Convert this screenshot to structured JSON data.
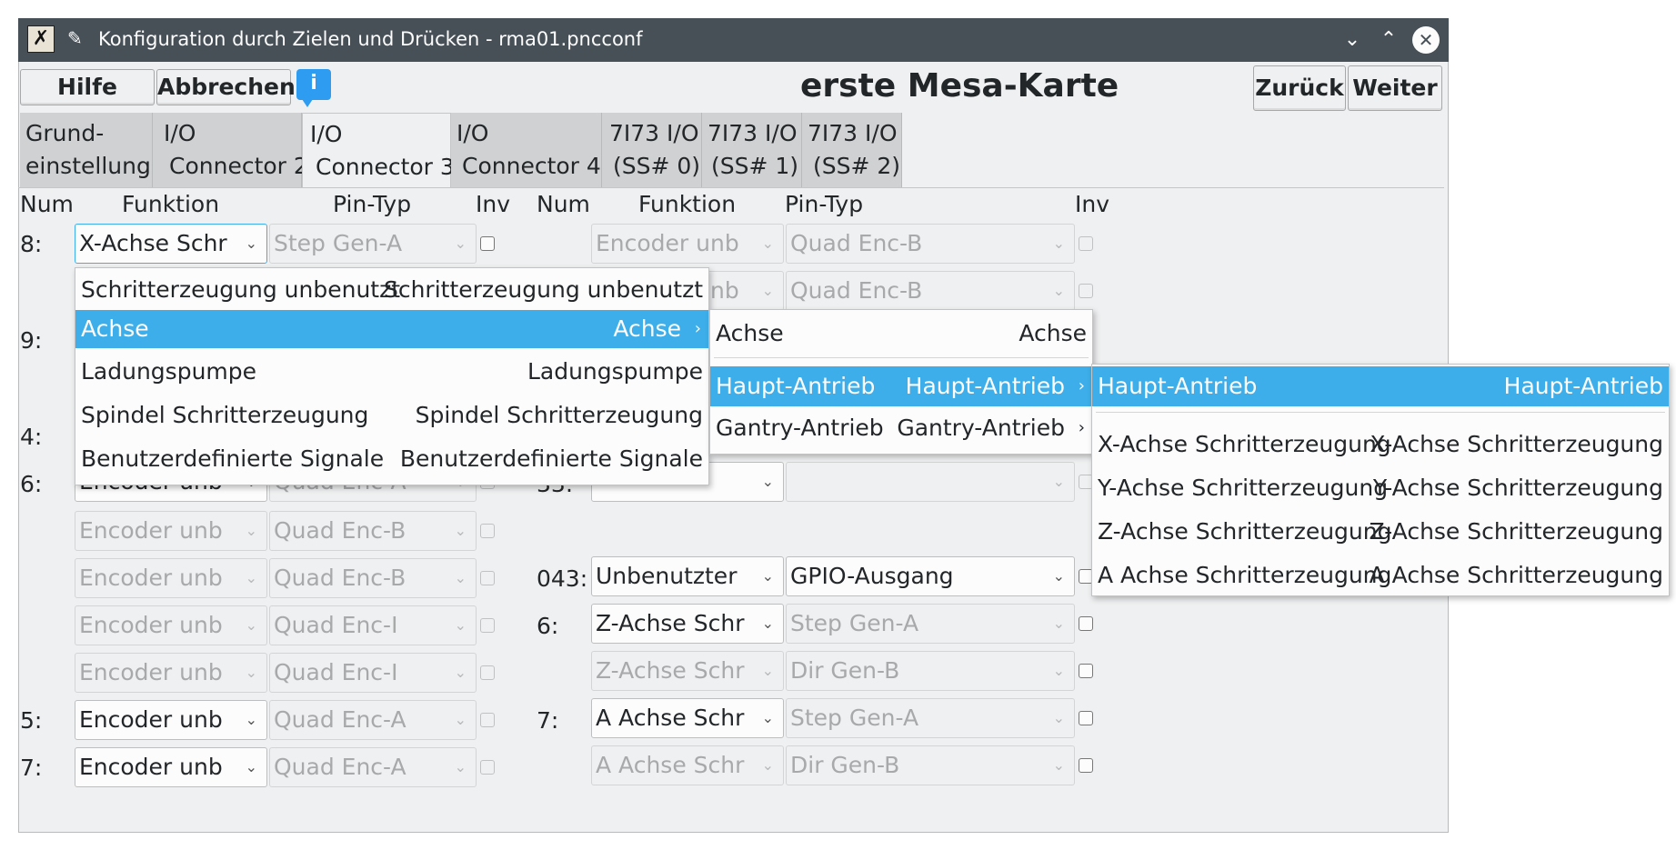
{
  "window": {
    "title": "Konfiguration durch Zielen und Drücken - rma01.pncconf"
  },
  "toolbar": {
    "help": "Hilfe",
    "cancel": "Abbrechen",
    "info_icon": "i",
    "heading": "erste Mesa-Karte",
    "back": "Zurück",
    "next": "Weiter"
  },
  "tabs": [
    {
      "line1": "Grund-",
      "line2": "einstellung"
    },
    {
      "line1": "I/O",
      "line2": "Connector 2"
    },
    {
      "line1": "I/O",
      "line2": "Connector 3"
    },
    {
      "line1": "I/O",
      "line2": "Connector 4"
    },
    {
      "line1": "7I73 I/O",
      "line2": "(SS# 0)"
    },
    {
      "line1": "7I73 I/O",
      "line2": "(SS# 1)"
    },
    {
      "line1": "7I73 I/O",
      "line2": "(SS# 2)"
    }
  ],
  "headers": {
    "num": "Num",
    "funktion": "Funktion",
    "pintyp": "Pin-Typ",
    "inv": "Inv"
  },
  "left_rows": [
    {
      "num": "8:",
      "func": "X-Achse Schr",
      "pin": "Step Gen-A"
    },
    {
      "num": "9:"
    },
    {
      "num": "4:"
    },
    {
      "num": "6:",
      "func": "Encoder unb",
      "pin": "Quad Enc-A"
    },
    {
      "func": "Encoder unb",
      "pin": "Quad Enc-B"
    },
    {
      "func": "Encoder unb",
      "pin": "Quad Enc-B"
    },
    {
      "func": "Encoder unb",
      "pin": "Quad Enc-I"
    },
    {
      "func": "Encoder unb",
      "pin": "Quad Enc-I"
    },
    {
      "num": "5:",
      "func": "Encoder unb",
      "pin": "Quad Enc-A"
    },
    {
      "num": "7:",
      "func": "Encoder unb",
      "pin": "Quad Enc-A"
    }
  ],
  "right_rows": [
    {
      "func": "Encoder unb",
      "pin": "Quad Enc-B"
    },
    {
      "func": "Encoder unb",
      "pin": "Quad Enc-B"
    },
    {
      "num": "33:",
      "func": "",
      "pin": ""
    },
    {
      "num": "043:",
      "func": "Unbenutzter",
      "pin": "GPIO-Ausgang"
    },
    {
      "num": "6:",
      "func": "Z-Achse Schr",
      "pin": "Step Gen-A"
    },
    {
      "func": "Z-Achse Schr",
      "pin": "Dir Gen-B"
    },
    {
      "num": "7:",
      "func": "A Achse Schr",
      "pin": "Step Gen-A"
    },
    {
      "func": "A Achse Schr",
      "pin": "Dir Gen-B"
    }
  ],
  "menu1": [
    {
      "left": "Schritterzeugung unbenutzt",
      "right": "Schritterzeugung unbenutzt"
    },
    {
      "left": "Achse",
      "right": "Achse",
      "has_submenu": true
    },
    {
      "left": "Ladungspumpe",
      "right": "Ladungspumpe"
    },
    {
      "left": "Spindel Schritterzeugung",
      "right": "Spindel Schritterzeugung"
    },
    {
      "left": "Benutzerdefinierte Signale",
      "right": "Benutzerdefinierte Signale"
    }
  ],
  "menu2": [
    {
      "left": "Achse",
      "right": "Achse"
    },
    {
      "left": "Haupt-Antrieb",
      "right": "Haupt-Antrieb",
      "has_submenu": true
    },
    {
      "left": "Gantry-Antrieb",
      "right": "Gantry-Antrieb",
      "has_submenu": true
    }
  ],
  "menu3": [
    {
      "left": "Haupt-Antrieb",
      "right": "Haupt-Antrieb"
    },
    {
      "left": "X-Achse Schritterzeugung",
      "right": "X-Achse Schritterzeugung"
    },
    {
      "left": "Y-Achse Schritterzeugung",
      "right": "Y-Achse Schritterzeugung"
    },
    {
      "left": "Z-Achse Schritterzeugung",
      "right": "Z-Achse Schritterzeugung"
    },
    {
      "left": "A Achse Schritterzeugung",
      "right": "A Achse Schritterzeugung"
    }
  ],
  "colors": {
    "selection": "#3daee9",
    "titlebar": "#475057",
    "window_bg": "#eff0f1"
  },
  "icons": [
    "app-icon",
    "pin-icon",
    "minimize-icon",
    "maximize-icon",
    "close-icon",
    "info-icon",
    "chevron-down-icon",
    "chevron-right-icon"
  ]
}
